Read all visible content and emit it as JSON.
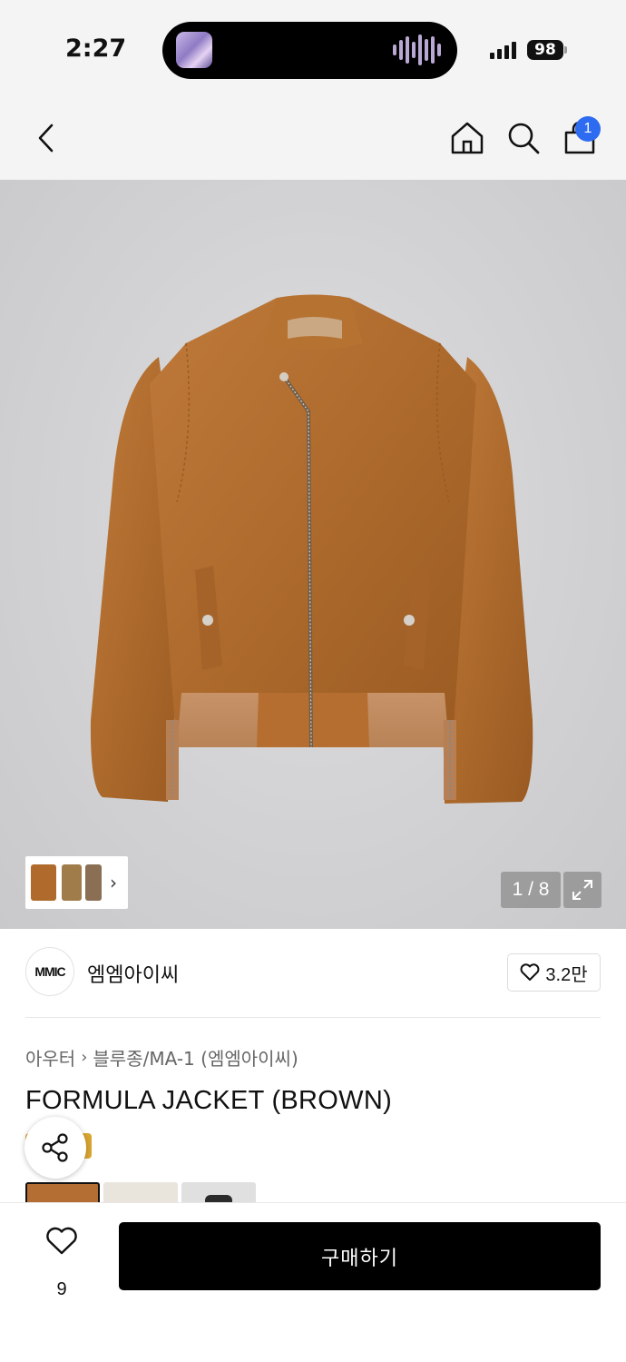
{
  "status_bar": {
    "time": "2:27",
    "battery": "98"
  },
  "nav": {
    "cart_badge": "1",
    "icons": [
      "back-icon",
      "home-icon",
      "search-icon",
      "bag-icon"
    ]
  },
  "product": {
    "image_counter": "1 / 8",
    "brand": {
      "logo_text": "MMIC",
      "name": "엠엠아이씨",
      "likes": "3.2만"
    },
    "breadcrumb": [
      "아우터",
      "블루종/MA-1 (엠엠아이씨)"
    ],
    "title": "FORMULA JACKET (BROWN)",
    "colors": {
      "jacket": "#b06a2c",
      "swatches": [
        "#b46e33",
        "#e9e4dc",
        "#2b2b2b"
      ]
    }
  },
  "bottom_bar": {
    "wish_count": "9",
    "buy_label": "구매하기"
  }
}
